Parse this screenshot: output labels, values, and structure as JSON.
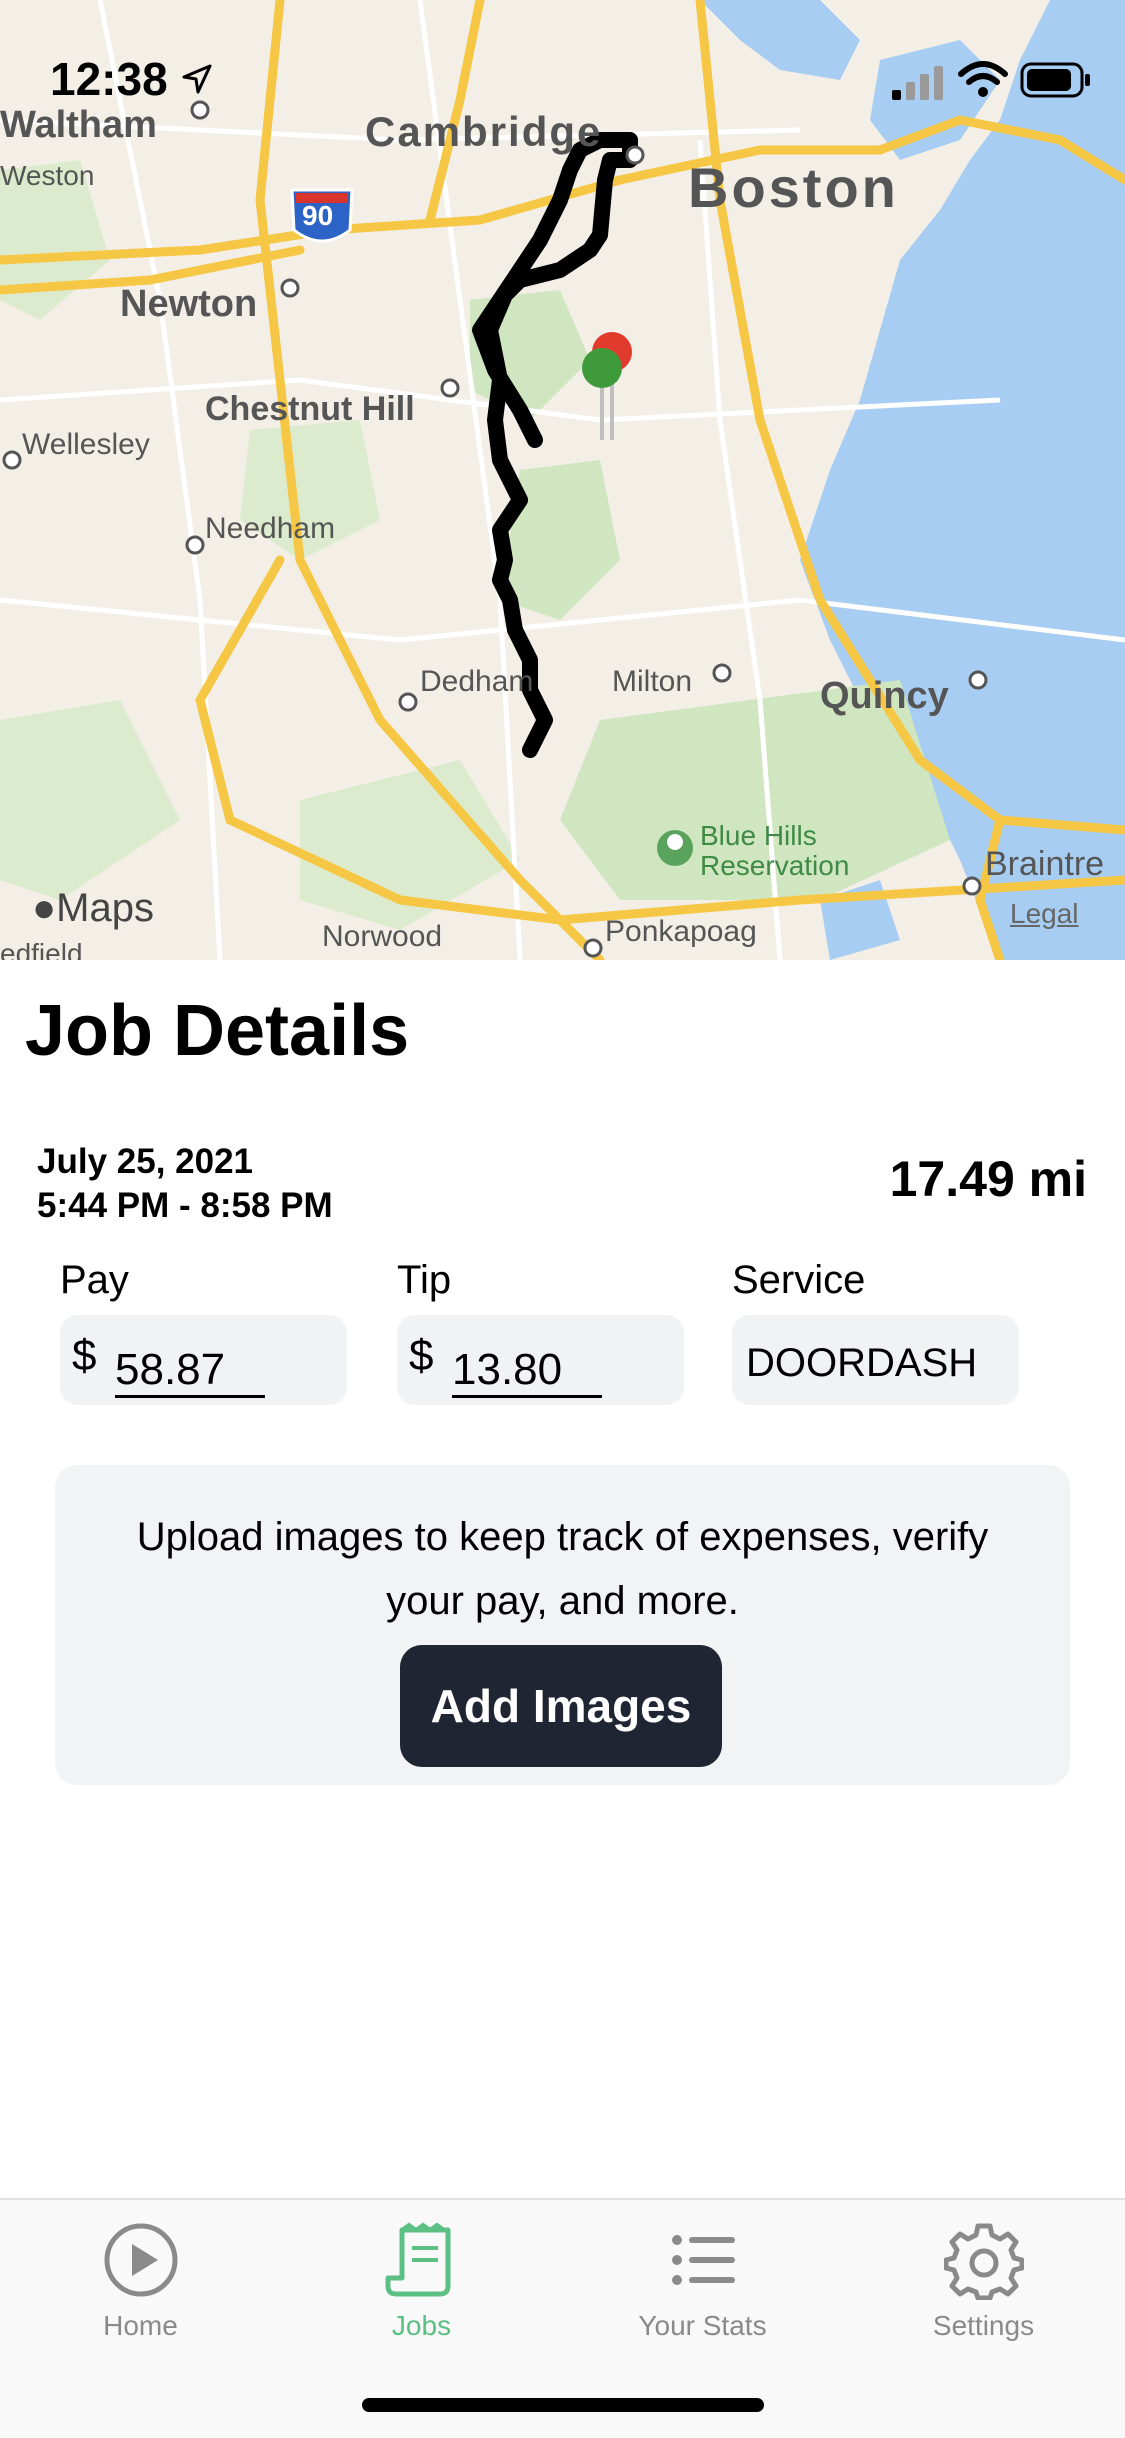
{
  "status_bar": {
    "time": "12:38"
  },
  "map": {
    "labels": {
      "waltham": "Waltham",
      "weston": "Weston",
      "cambridge": "Cambridge",
      "boston": "Boston",
      "newton": "Newton",
      "chestnut_hill": "Chestnut Hill",
      "wellesley": "Wellesley",
      "needham": "Needham",
      "dedham": "Dedham",
      "milton": "Milton",
      "quincy": "Quincy",
      "blue_hills": "Blue Hills",
      "reservation": "Reservation",
      "braintree": "Braintre",
      "norwood": "Norwood",
      "ponkapoag": "Ponkapoag",
      "medfield": "edfield",
      "interstate": "90",
      "maps_brand": "Maps",
      "legal": "Legal"
    }
  },
  "job": {
    "title": "Job Details",
    "date": "July 25, 2021",
    "time_range": "5:44 PM - 8:58 PM",
    "distance": "17.49 mi",
    "pay_label": "Pay",
    "pay_currency": "$",
    "pay_value": "58.87",
    "tip_label": "Tip",
    "tip_currency": "$",
    "tip_value": "13.80",
    "service_label": "Service",
    "service_value": "DOORDASH"
  },
  "upload": {
    "text": "Upload images to keep track of expenses, verify your pay, and more.",
    "button_label": "Add Images"
  },
  "tab_bar": {
    "tabs": [
      {
        "label": "Home",
        "icon": "play-circle-icon"
      },
      {
        "label": "Jobs",
        "icon": "receipt-icon"
      },
      {
        "label": "Your Stats",
        "icon": "list-icon"
      },
      {
        "label": "Settings",
        "icon": "gear-icon"
      }
    ],
    "active": "Jobs"
  },
  "colors": {
    "accent": "#5cbf84",
    "button_dark": "#1f2532",
    "water": "#a7cdf2",
    "park": "#cfe6c0",
    "highway": "#f6c744"
  }
}
